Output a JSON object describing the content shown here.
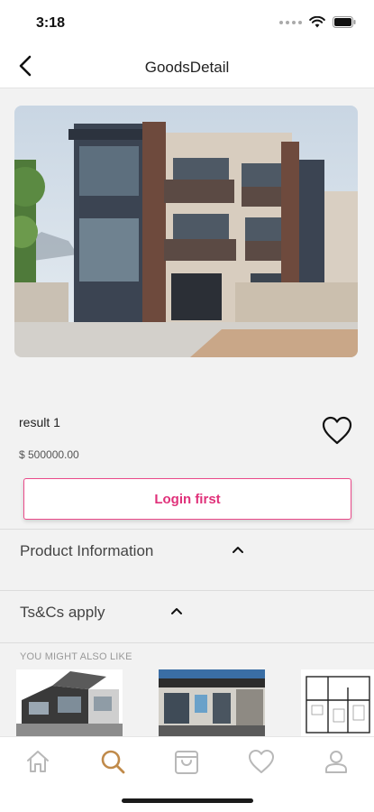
{
  "status_bar": {
    "time": "3:18"
  },
  "nav": {
    "title": "GoodsDetail",
    "back_icon": "chevron-left-icon"
  },
  "product": {
    "name": "result 1",
    "price": "$ 500000.00",
    "favorite_icon": "heart-outline-icon"
  },
  "login_button": {
    "label": "Login first"
  },
  "sections": [
    {
      "label": "Product Information",
      "icon": "chevron-up-icon"
    },
    {
      "label": "Ts&Cs apply",
      "icon": "chevron-up-icon"
    }
  ],
  "recommendations": {
    "title": "YOU MIGHT ALSO LIKE"
  },
  "tab_bar": {
    "items": [
      "home-icon",
      "search-icon",
      "shopping-bag-icon",
      "heart-icon",
      "profile-icon"
    ],
    "active": "search-icon"
  },
  "colors": {
    "accent": "#e0317a",
    "tab_active": "#c08a4a",
    "tab_inactive": "#b8b8b8"
  }
}
